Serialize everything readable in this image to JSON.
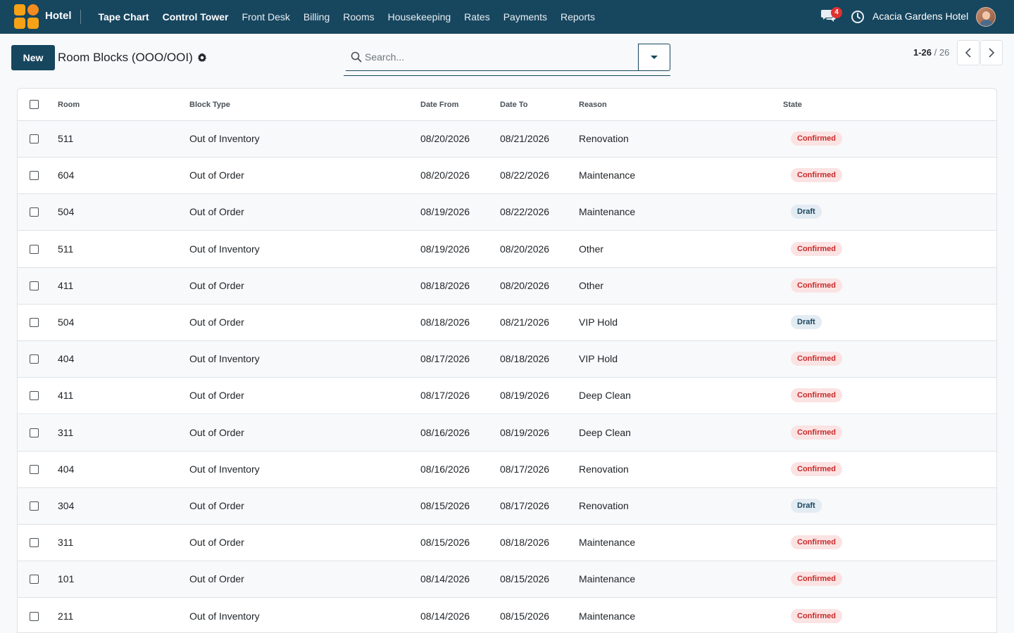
{
  "navbar": {
    "app_name": "Hotel",
    "menu": [
      {
        "label": "Tape Chart",
        "bold": true
      },
      {
        "label": "Control Tower",
        "bold": true
      },
      {
        "label": "Front Desk",
        "bold": false
      },
      {
        "label": "Billing",
        "bold": false
      },
      {
        "label": "Rooms",
        "bold": false
      },
      {
        "label": "Housekeeping",
        "bold": false
      },
      {
        "label": "Rates",
        "bold": false
      },
      {
        "label": "Payments",
        "bold": false
      },
      {
        "label": "Reports",
        "bold": false
      }
    ],
    "chat_badge": "4",
    "company": "Acacia Gardens Hotel"
  },
  "control": {
    "new_label": "New",
    "breadcrumb": "Room Blocks (OOO/OOI)",
    "search_placeholder": "Search...",
    "pager_range": "1-26",
    "pager_sep": " / ",
    "pager_total": "26"
  },
  "table": {
    "headers": {
      "room": "Room",
      "block_type": "Block Type",
      "date_from": "Date From",
      "date_to": "Date To",
      "reason": "Reason",
      "state": "State"
    },
    "rows": [
      {
        "room": "511",
        "block_type": "Out of Inventory",
        "date_from": "08/20/2026",
        "date_to": "08/21/2026",
        "reason": "Renovation",
        "state": "Confirmed"
      },
      {
        "room": "604",
        "block_type": "Out of Order",
        "date_from": "08/20/2026",
        "date_to": "08/22/2026",
        "reason": "Maintenance",
        "state": "Confirmed"
      },
      {
        "room": "504",
        "block_type": "Out of Order",
        "date_from": "08/19/2026",
        "date_to": "08/22/2026",
        "reason": "Maintenance",
        "state": "Draft"
      },
      {
        "room": "511",
        "block_type": "Out of Inventory",
        "date_from": "08/19/2026",
        "date_to": "08/20/2026",
        "reason": "Other",
        "state": "Confirmed"
      },
      {
        "room": "411",
        "block_type": "Out of Order",
        "date_from": "08/18/2026",
        "date_to": "08/20/2026",
        "reason": "Other",
        "state": "Confirmed"
      },
      {
        "room": "504",
        "block_type": "Out of Order",
        "date_from": "08/18/2026",
        "date_to": "08/21/2026",
        "reason": "VIP Hold",
        "state": "Draft"
      },
      {
        "room": "404",
        "block_type": "Out of Inventory",
        "date_from": "08/17/2026",
        "date_to": "08/18/2026",
        "reason": "VIP Hold",
        "state": "Confirmed"
      },
      {
        "room": "411",
        "block_type": "Out of Order",
        "date_from": "08/17/2026",
        "date_to": "08/19/2026",
        "reason": "Deep Clean",
        "state": "Confirmed"
      },
      {
        "room": "311",
        "block_type": "Out of Order",
        "date_from": "08/16/2026",
        "date_to": "08/19/2026",
        "reason": "Deep Clean",
        "state": "Confirmed"
      },
      {
        "room": "404",
        "block_type": "Out of Inventory",
        "date_from": "08/16/2026",
        "date_to": "08/17/2026",
        "reason": "Renovation",
        "state": "Confirmed"
      },
      {
        "room": "304",
        "block_type": "Out of Order",
        "date_from": "08/15/2026",
        "date_to": "08/17/2026",
        "reason": "Renovation",
        "state": "Draft"
      },
      {
        "room": "311",
        "block_type": "Out of Order",
        "date_from": "08/15/2026",
        "date_to": "08/18/2026",
        "reason": "Maintenance",
        "state": "Confirmed"
      },
      {
        "room": "101",
        "block_type": "Out of Order",
        "date_from": "08/14/2026",
        "date_to": "08/15/2026",
        "reason": "Maintenance",
        "state": "Confirmed"
      },
      {
        "room": "211",
        "block_type": "Out of Inventory",
        "date_from": "08/14/2026",
        "date_to": "08/15/2026",
        "reason": "Maintenance",
        "state": "Confirmed"
      }
    ]
  },
  "colors": {
    "primary": "#17465f",
    "confirmed_bg": "#fbe3e3",
    "confirmed_fg": "#c92a2a",
    "draft_bg": "#e3ebf3",
    "draft_fg": "#17465f"
  }
}
